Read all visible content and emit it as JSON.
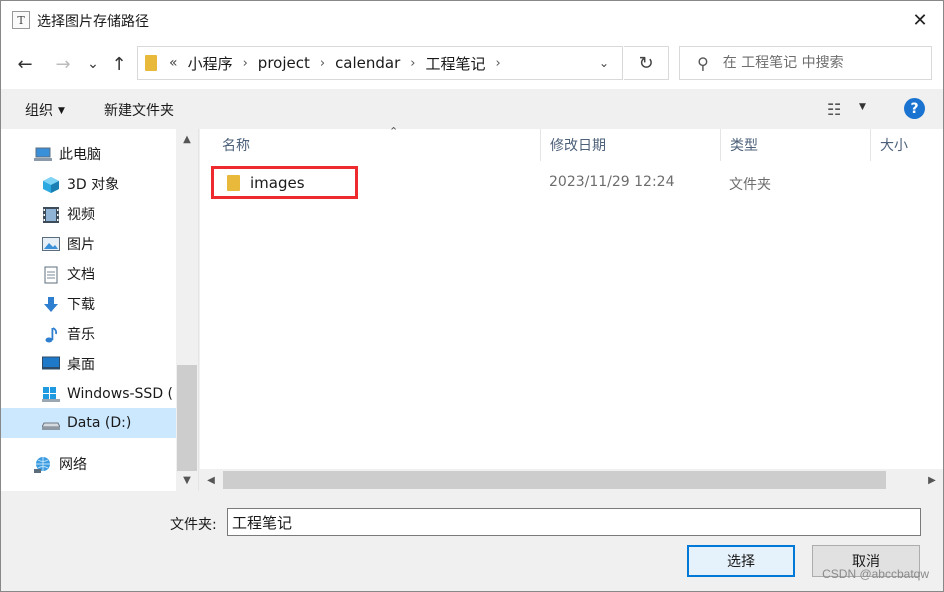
{
  "window": {
    "title": "选择图片存储路径",
    "app_icon_glyph": "T",
    "close_glyph": "✕"
  },
  "nav": {
    "back_glyph": "←",
    "forward_glyph": "→",
    "recent_glyph": "⌄",
    "up_glyph": "↑",
    "breadcrumb_overflow": "«",
    "breadcrumbs": [
      "小程序",
      "project",
      "calendar",
      "工程笔记"
    ],
    "breadcrumb_sep": "›",
    "dropdown_glyph": "⌄",
    "refresh_glyph": "↻"
  },
  "search": {
    "placeholder": "在 工程笔记 中搜索",
    "icon_glyph": "⚲"
  },
  "toolbar": {
    "organize_label": "组织",
    "organize_caret": "▼",
    "new_folder_label": "新建文件夹",
    "view_glyph": "☷",
    "view_caret": "▼",
    "help_glyph": "?"
  },
  "sidebar": {
    "items": [
      {
        "label": "此电脑",
        "icon": "computer-icon"
      },
      {
        "label": "3D 对象",
        "icon": "3d-objects-icon"
      },
      {
        "label": "视频",
        "icon": "videos-icon"
      },
      {
        "label": "图片",
        "icon": "pictures-icon"
      },
      {
        "label": "文档",
        "icon": "documents-icon"
      },
      {
        "label": "下载",
        "icon": "downloads-icon"
      },
      {
        "label": "音乐",
        "icon": "music-icon"
      },
      {
        "label": "桌面",
        "icon": "desktop-icon"
      },
      {
        "label": "Windows-SSD (",
        "icon": "windows-drive-icon"
      },
      {
        "label": "Data (D:)",
        "icon": "drive-icon"
      },
      {
        "label": "网络",
        "icon": "network-icon"
      }
    ],
    "scroll_up_glyph": "▲",
    "scroll_down_glyph": "▼"
  },
  "file_list": {
    "columns": [
      "名称",
      "修改日期",
      "类型",
      "大小"
    ],
    "sort_glyph": "⌃",
    "rows": [
      {
        "name": "images",
        "modified": "2023/11/29 12:24",
        "type": "文件夹",
        "size": ""
      }
    ],
    "scroll_left_glyph": "◀",
    "scroll_right_glyph": "▶"
  },
  "footer": {
    "folder_label": "文件夹:",
    "folder_value": "工程笔记",
    "select_label": "选择",
    "cancel_label": "取消"
  },
  "watermark": "CSDN @abccbatqw",
  "colors": {
    "accent": "#0078d7",
    "highlight_box": "#ee2a2f",
    "folder": "#e8b93a",
    "selection": "#cce8ff",
    "help": "#1a73d0"
  }
}
